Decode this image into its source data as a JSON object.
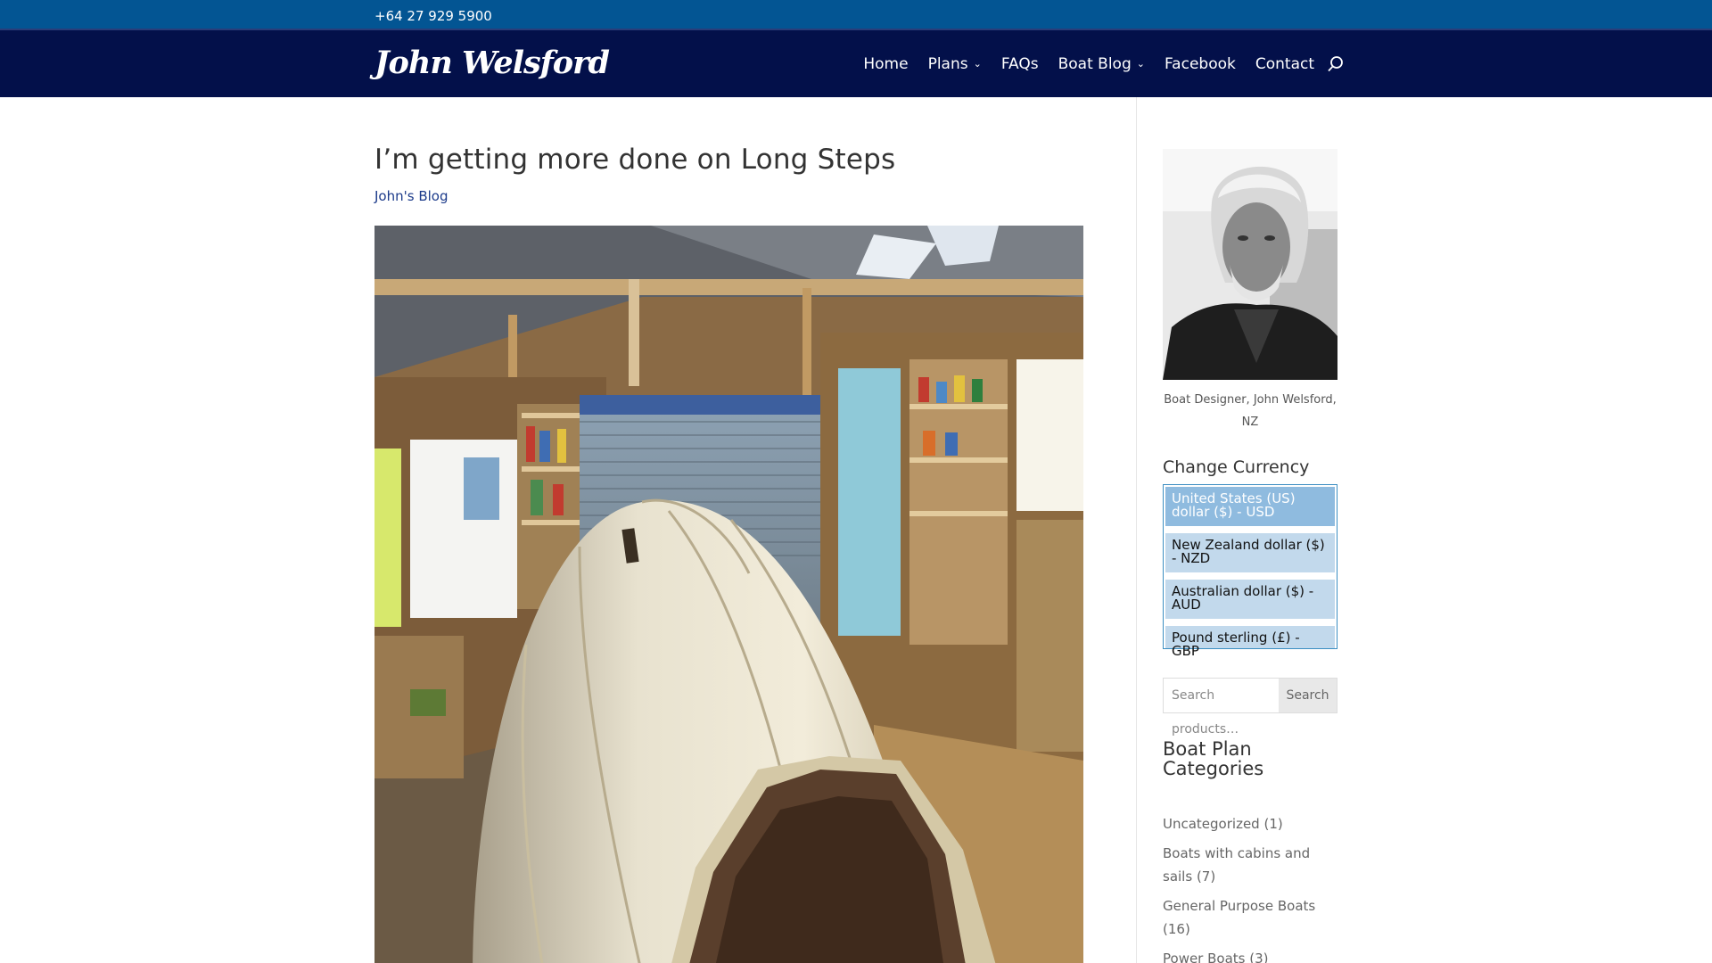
{
  "topbar": {
    "phone": "+64 27 929 5900"
  },
  "header": {
    "logo_text": "John Welsford",
    "nav": [
      {
        "label": "Home",
        "has_dropdown": false
      },
      {
        "label": "Plans",
        "has_dropdown": true
      },
      {
        "label": "FAQs",
        "has_dropdown": false
      },
      {
        "label": "Boat Blog",
        "has_dropdown": true
      },
      {
        "label": "Facebook",
        "has_dropdown": false
      },
      {
        "label": "Contact",
        "has_dropdown": false
      }
    ],
    "search_icon": "search-icon"
  },
  "post": {
    "title": "I’m getting more done on Long Steps",
    "category": "John's Blog",
    "image_desc_icon": "boat-hull-in-workshop-photo"
  },
  "sidebar": {
    "portrait_caption": "Boat Designer, John Welsford, NZ",
    "currency": {
      "title": "Change Currency",
      "options": [
        {
          "label": "United States (US) dollar ($) - USD",
          "selected": true
        },
        {
          "label": "New Zealand dollar ($) - NZD",
          "selected": false
        },
        {
          "label": "Australian dollar ($) - AUD",
          "selected": false
        },
        {
          "label": "Pound sterling (£) - GBP",
          "selected": false
        }
      ]
    },
    "product_search": {
      "placeholder": "Search products…",
      "button": "Search"
    },
    "categories": {
      "title": "Boat Plan Categories",
      "items": [
        {
          "name": "Uncategorized",
          "count": "(1)"
        },
        {
          "name": "Boats with cabins and sails",
          "count": "(7)"
        },
        {
          "name": "General Purpose Boats",
          "count": "(16)"
        },
        {
          "name": "Power Boats",
          "count": "(3)"
        }
      ]
    }
  },
  "colors": {
    "topbar": "#035593",
    "header": "#03104a",
    "link": "#1b3a8a",
    "currency_selected": "#8fbbdf",
    "currency_option": "#c2d9ec"
  }
}
